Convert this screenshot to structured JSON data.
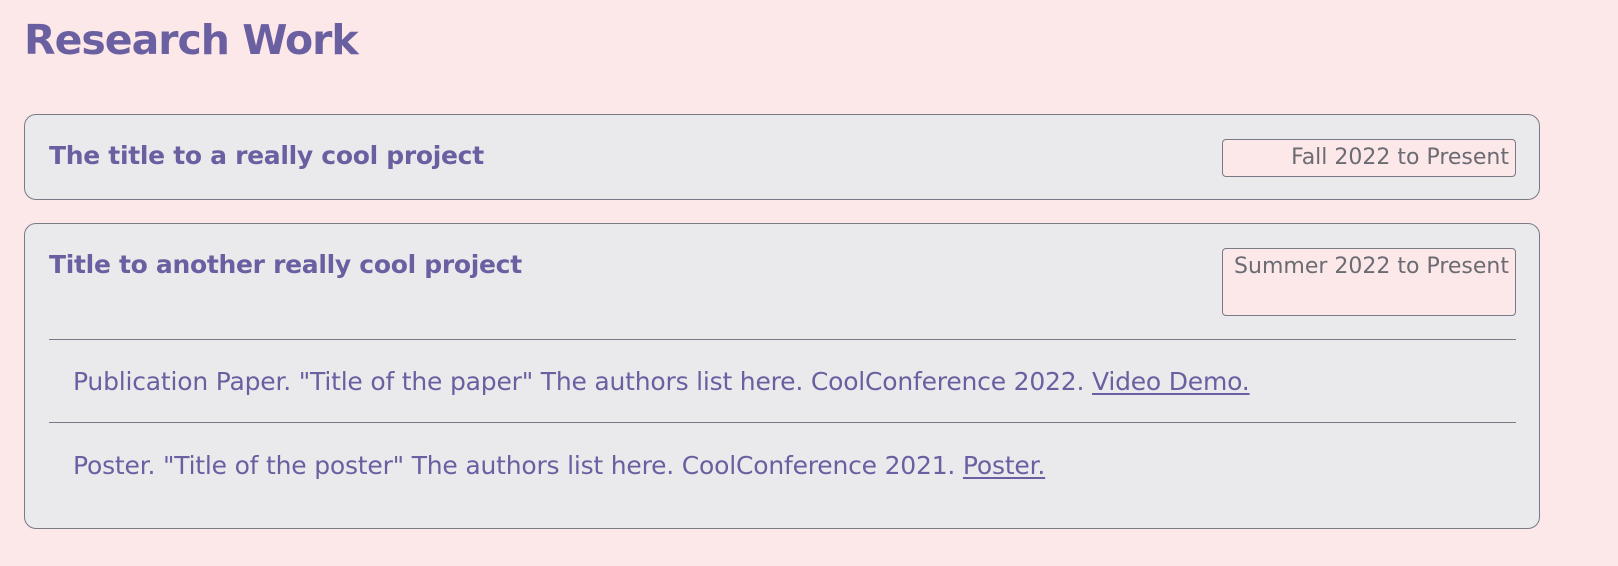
{
  "page_title": "Research Work",
  "projects": [
    {
      "title": "The title to a really cool project",
      "date": "Fall 2022 to Present"
    },
    {
      "title": "Title to another really cool project",
      "date": "Summer 2022 to Present",
      "items": [
        {
          "text": "Publication Paper. \"Title of the paper\" The authors list here. CoolConference 2022. ",
          "link_label": "Video Demo."
        },
        {
          "text": "Poster. \"Title of the poster\" The authors list here. CoolConference 2021. ",
          "link_label": "Poster."
        }
      ]
    }
  ],
  "colors": {
    "background": "#fce8e8",
    "card_background": "#eaeaec",
    "accent": "#6a5fa0",
    "border": "#7a7a86",
    "date_text": "#6b6b73"
  }
}
